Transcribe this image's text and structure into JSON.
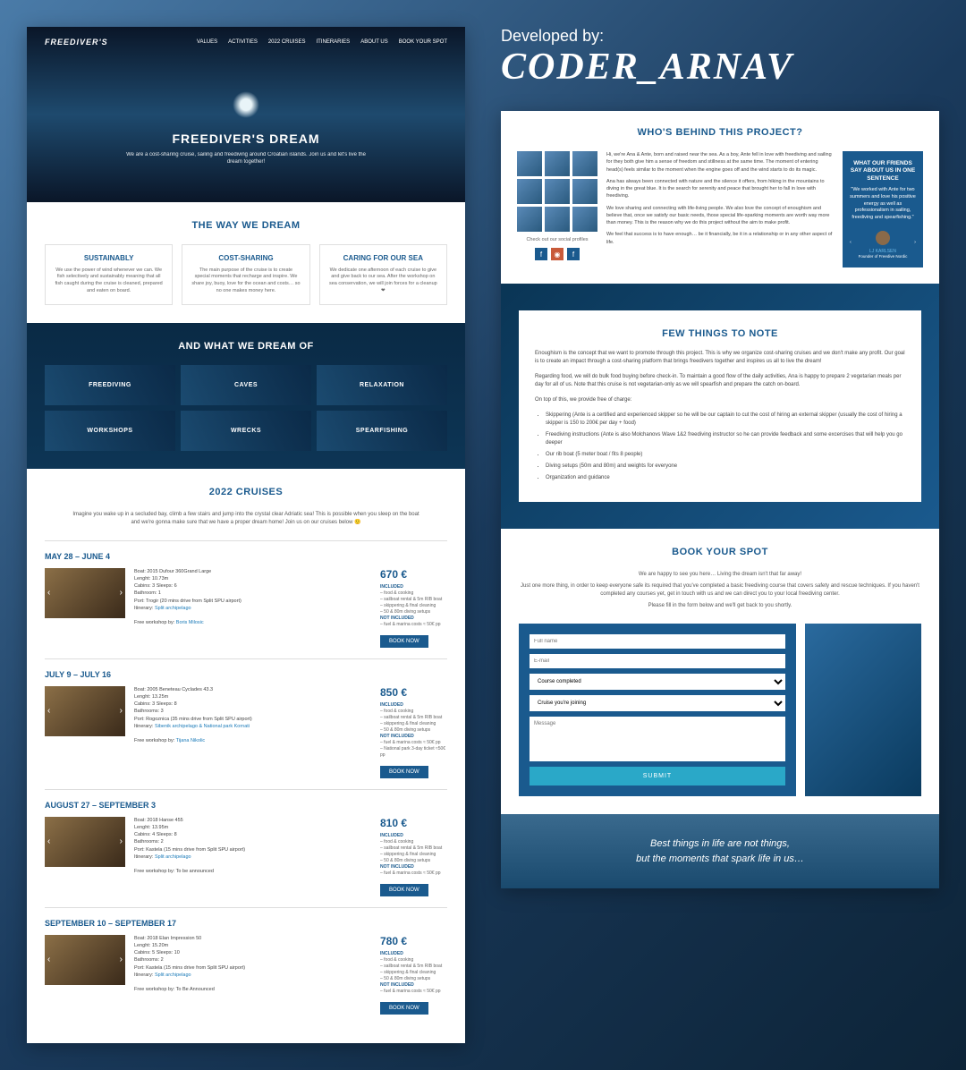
{
  "dev": {
    "label": "Developed by:",
    "name": "CODER_ARNAV"
  },
  "logo": "FREEDIVER'S",
  "nav": [
    "VALUES",
    "ACTIVITIES",
    "2022 CRUISES",
    "ITINERARIES",
    "ABOUT US",
    "BOOK YOUR SPOT"
  ],
  "hero": {
    "title": "FREEDIVER'S DREAM",
    "sub": "We are a cost-sharing cruise, sailing and freediving around Croatian islands. Join us and let's live the dream together!"
  },
  "dream": {
    "title": "THE WAY WE DREAM",
    "cards": [
      {
        "h": "SUSTAINABLY",
        "p": "We use the power of wind whenever we can. We fish selectively and sustainably meaning that all fish caught during the cruise is cleaned, prepared and eaten on board."
      },
      {
        "h": "COST-SHARING",
        "p": "The main purpose of the cruise is to create special moments that recharge and inspire. We share joy, buoy, love for the ocean and costs… so no one makes money here."
      },
      {
        "h": "CARING FOR OUR SEA",
        "p": "We dedicate one afternoon of each cruise to give and give back to our sea. After the workshop on sea conservation, we will join forces for a cleanup ❤"
      }
    ]
  },
  "dreamof": {
    "title": "AND WHAT WE DREAM OF",
    "tiles": [
      "FREEDIVING",
      "CAVES",
      "RELAXATION",
      "WORKSHOPS",
      "WRECKS",
      "SPEARFISHING"
    ]
  },
  "cruises": {
    "title": "2022 CRUISES",
    "intro": "Imagine you wake up in a secluded bay, climb a few stairs and jump into the crystal clear Adriatic sea! This is possible when you sleep on the boat and we're gonna make sure that we have a proper dream home! Join us on our cruises below 🙂",
    "items": [
      {
        "date": "MAY 28 – JUNE 4",
        "boat": "Boat: 2015 Dufour 360Grand Large",
        "len": "Lenght: 10.73m",
        "cab": "Cabins: 3   Sleeps: 6",
        "bath": "Bathroom: 1",
        "port": "Port: Trogir (20 mins drive from Split SPU airport)",
        "itin": "Itinerary: ",
        "itinlink": "Split archipelago",
        "work": "Free workshop by: ",
        "worklink": "Boris Milosic",
        "price": "670 €",
        "inc": "INCLUDED",
        "inc1": "– food & cooking",
        "inc2": "– sailboat rental & 5m RIB boat",
        "inc3": "– skippering & final cleaning",
        "inc4": "– 50 & 80m diving setups",
        "ninc": "NOT INCLUDED",
        "ninc1": "– fuel & marina costs ≈ 50€ pp"
      },
      {
        "date": "JULY 9 – JULY 16",
        "boat": "Boat: 2005 Beneteau Cyclades 43.3",
        "len": "Lenght: 13.25m",
        "cab": "Cabins: 3   Sleeps: 8",
        "bath": "Bathrooms: 3",
        "port": "Port: Rogoznica (35 mins drive from Split SPU airport)",
        "itin": "Itinerary: ",
        "itinlink": "Sibenik archipelago & National park Kornati",
        "work": "Free workshop by: ",
        "worklink": "Tijana Nikolic",
        "price": "850 €",
        "inc": "INCLUDED",
        "inc1": "– food & cooking",
        "inc2": "– sailboat rental & 5m RIB boat",
        "inc3": "– skippering & final cleaning",
        "inc4": "– 50 & 80m diving setups",
        "ninc": "NOT INCLUDED",
        "ninc1": "– fuel & marina costs ≈ 50€ pp",
        "ninc2": "– National park 3-day ticket ≈50€ pp"
      },
      {
        "date": "AUGUST 27 – SEPTEMBER 3",
        "boat": "Boat: 2018 Hanse 455",
        "len": "Lenght: 13.95m",
        "cab": "Cabins: 4   Sleeps: 8",
        "bath": "Bathrooms: 2",
        "port": "Port: Kastela (15 mins drive from Split SPU airport)",
        "itin": "Itinerary: ",
        "itinlink": "Split archipelago",
        "work": "Free workshop by: To be announced",
        "worklink": "",
        "price": "810 €",
        "inc": "INCLUDED",
        "inc1": "– food & cooking",
        "inc2": "– sailboat rental & 5m RIB boat",
        "inc3": "– skippering & final cleaning",
        "inc4": "– 50 & 80m diving setups",
        "ninc": "NOT INCLUDED",
        "ninc1": "– fuel & marina costs ≈ 50€ pp"
      },
      {
        "date": "SEPTEMBER 10 – SEPTEMBER 17",
        "boat": "Boat: 2018 Elan Impression 50",
        "len": "Lenght: 15.20m",
        "cab": "Cabins: 5   Sleeps: 10",
        "bath": "Bathrooms: 2",
        "port": "Port: Kastela (15 mins drive from Split SPU airport)",
        "itin": "Itinerary: ",
        "itinlink": "Split archipelago",
        "work": "Free workshop by: To Be Announced",
        "worklink": "",
        "price": "780 €",
        "inc": "INCLUDED",
        "inc1": "– food & cooking",
        "inc2": "– sailboat rental & 5m RIB boat",
        "inc3": "– skippering & final cleaning",
        "inc4": "– 50 & 80m diving setups",
        "ninc": "NOT INCLUDED",
        "ninc1": "– fuel & marina costs ≈ 50€ pp"
      }
    ],
    "book": "BOOK NOW"
  },
  "behind": {
    "title": "WHO'S BEHIND THIS PROJECT?",
    "p1": "Hi, we're Ana & Ante, born and raised near the sea. As a boy, Ante fell in love with freediving and sailing for they both give him a sense of freedom and stillness at the same time. The moment of entering head(s) feels similar to the moment when the engine goes off and the wind starts to do its magic.",
    "p2": "Ana has always been connected with nature and the silence it offers, from hiking in the mountains to diving in the great blue. It is the search for serenity and peace that brought her to fall in love with freediving.",
    "p3": "We love sharing and connecting with life-living people. We also love the concept of enoughism and believe that, once we satisfy our basic needs, those special life-sparking moments are worth way more than money. This is the reason why we do this project without the aim to make profit.",
    "p4": "We feel that success is to have enough… be it financially, be it in a relationship or in any other aspect of life.",
    "checkout": "Check out our social profiles",
    "test": {
      "h": "WHAT OUR FRIENDS SAY ABOUT US IN ONE SENTENCE",
      "p": "\"We worked with Ante for two summers and love his positive energy as well as professionalism in sailing, freediving and spearfishing.\"",
      "author": "LJ KARLSEN",
      "role": "Founder of Freedive Nordic"
    }
  },
  "notes": {
    "title": "FEW THINGS TO NOTE",
    "p1": "Enoughism is the concept that we want to promote through this project. This is why we organize cost-sharing cruises and we don't make any profit. Our goal is to create an impact through a cost-sharing platform that brings freedivers together and inspires us all to live the dream!",
    "p2": "Regarding food, we will do bulk food buying before check-in. To maintain a good flow of the daily activities, Ana is happy to prepare 2 vegetarian meals per day for all of us. Note that this cruise is not vegetarian-only as we will spearfish and prepare the catch on-board.",
    "p3": "On top of this, we provide free of charge:",
    "li1": "Skippering (Ante is a certified and experienced skipper so he will be our captain to cut the cost of hiring an external skipper (usually the cost of hiring a skipper is 150 to 200€ per day + food)",
    "li2": "Freediving instructions (Ante is also Molchanovs Wave 1&2 freediving instructor so he can provide feedback and some excercises that will help you go deeper",
    "li3": "Our rib boat (5 meter boat / fits 8 people)",
    "li4": "Diving setups (50m and 80m) and weights for everyone",
    "li5": "Organization and guidance"
  },
  "booksec": {
    "title": "BOOK YOUR SPOT",
    "p1": "We are happy to see you here… Living the dream isn't that far away!",
    "p2": "Just one more thing, in order to keep everyone safe its required that you've completed a basic freediving course that covers safety and rescue techniques. If you haven't completed any courses yet, get in touch with us and we can direct you to your local freediving center.",
    "p3": "Please fill in the form below and we'll get back to you shortly.",
    "ph_name": "Full name",
    "ph_email": "E-mail",
    "ph_course": "Course completed",
    "ph_cruise": "Cruise you're joining",
    "ph_msg": "Message",
    "submit": "SUBMIT"
  },
  "quote": {
    "l1": "Best things in life are not things,",
    "l2": "but the moments that spark life in us…"
  }
}
